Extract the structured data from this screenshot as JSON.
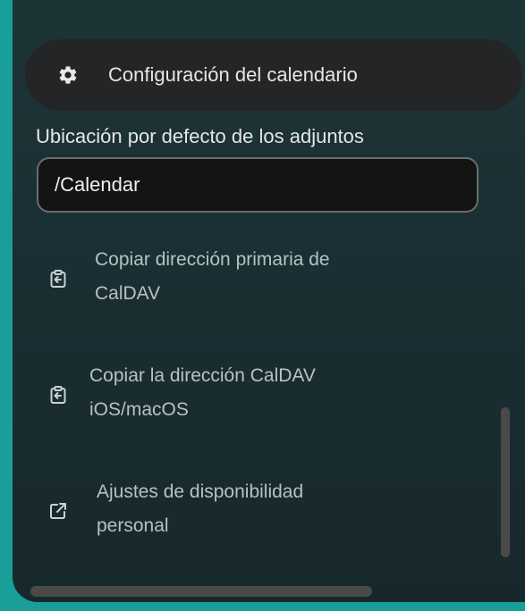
{
  "settings": {
    "title": "Configuración del calendario",
    "icon": "gear-icon"
  },
  "attachments": {
    "label": "Ubicación por defecto de los adjuntos",
    "value": "/Calendar"
  },
  "actions": [
    {
      "label_line1": "Copiar dirección primaria de",
      "label_line2": "CalDAV",
      "icon": "clipboard-copy-icon"
    },
    {
      "label_line1": "Copiar la dirección CalDAV",
      "label_line2": "iOS/macOS",
      "icon": "clipboard-copy-icon"
    },
    {
      "label_line1": "Ajustes de disponibilidad",
      "label_line2": "personal",
      "icon": "external-link-icon"
    }
  ],
  "colors": {
    "frame_accent": "#1a9e9a",
    "panel_bg": "#1d3437",
    "header_bg": "#242526",
    "text_primary": "#e6e6e6",
    "text_secondary": "#b6c2c2"
  }
}
